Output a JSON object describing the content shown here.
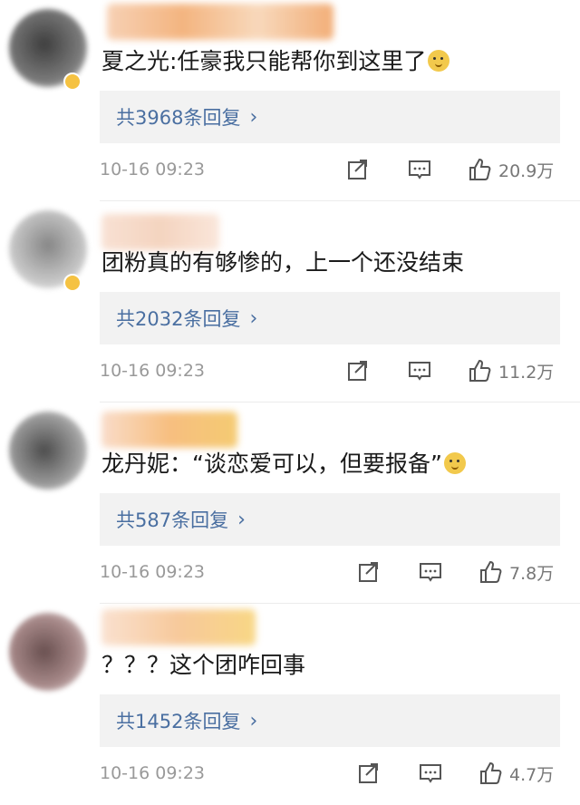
{
  "comments": [
    {
      "text": "夏之光:任豪我只能帮你到这里了",
      "has_emoji": true,
      "reply_label": "共3968条回复",
      "time": "10-16 09:23",
      "likes": "20.9万",
      "avatar_color": "#3a3a3a",
      "name_color": "#f0a070"
    },
    {
      "text": "团粉真的有够惨的，上一个还没结束",
      "has_emoji": false,
      "reply_label": "共2032条回复",
      "time": "10-16 09:23",
      "likes": "11.2万",
      "avatar_color": "#8a8a8a",
      "name_color": "#f4d2b8"
    },
    {
      "text": "龙丹妮：“谈恋爱可以，但要报备”",
      "has_emoji": true,
      "reply_label": "共587条回复",
      "time": "10-16 09:23",
      "likes": "7.8万",
      "avatar_color": "#555555",
      "name_color": "#f6b05c"
    },
    {
      "text": "？？？这个团咋回事",
      "has_emoji": false,
      "reply_label": "共1452条回复",
      "time": "10-16 09:23",
      "likes": "4.7万",
      "avatar_color": "#7a5a5a",
      "name_color": "#f7c07a"
    }
  ],
  "icons": {
    "share": "share-icon",
    "comment": "comment-icon",
    "like": "thumbs-up-icon",
    "reply_chevron": "chevron-right-icon"
  },
  "chevron": "›"
}
